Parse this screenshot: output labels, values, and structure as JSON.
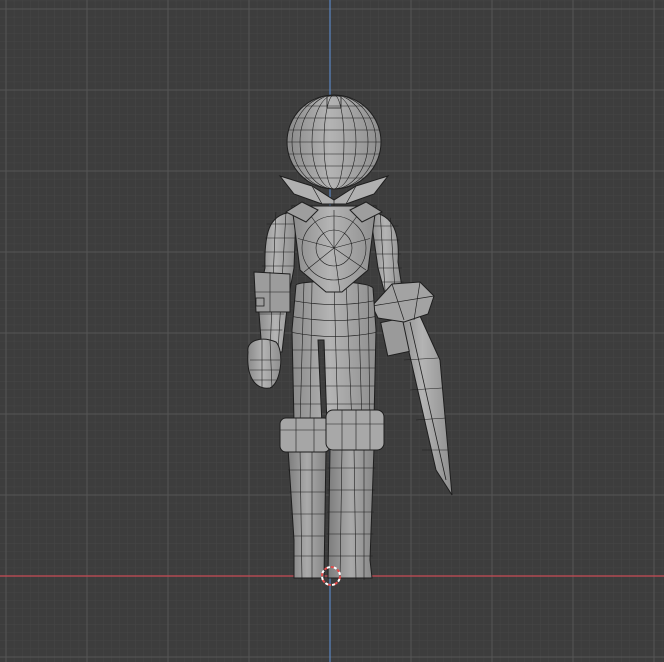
{
  "viewport": {
    "background_color": "#3d3d3d",
    "grid_minor_color": "#474747",
    "grid_major_color": "#555555",
    "x_axis_color": "#c84c56",
    "y_axis_color": "#5a86c2",
    "view": "front-orthographic",
    "shading": "solid-with-wireframe-overlay"
  },
  "scene": {
    "object": {
      "type": "character-mesh",
      "mesh_color": "#a9a9a9",
      "wire_color": "#1e1e1e",
      "parts": [
        "head",
        "collar",
        "torso",
        "left-arm",
        "right-arm",
        "fist",
        "gauntlet",
        "pants",
        "boots",
        "sword"
      ]
    },
    "cursor": {
      "icon": "3d-cursor-icon",
      "ring_colors": [
        "#e44c4c",
        "#ffffff"
      ]
    }
  }
}
